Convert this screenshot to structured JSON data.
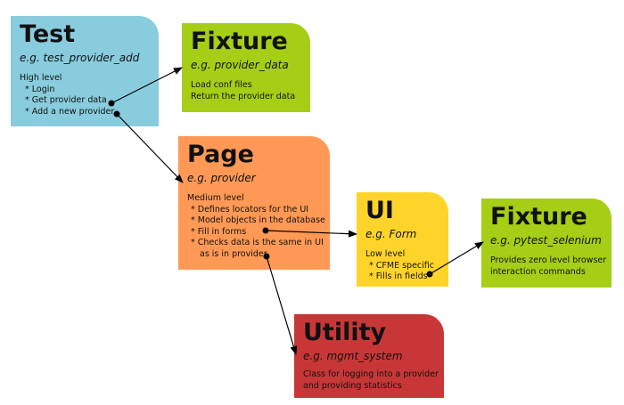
{
  "colors": {
    "test": "#88CCDD",
    "fixture": "#A6CE16",
    "page": "#FF9955",
    "ui": "#FFD42A",
    "utility": "#C83737",
    "arrow": "#000000"
  },
  "boxes": {
    "test": {
      "title": "Test",
      "example": "e.g. test_provider_add",
      "lines": [
        "High level",
        "* Login",
        "* Get provider data",
        "* Add a new provider"
      ]
    },
    "fixture_top": {
      "title": "Fixture",
      "example": "e.g. provider_data",
      "lines": [
        "Load conf files",
        "Return the provider data"
      ]
    },
    "page": {
      "title": "Page",
      "example": "e.g. provider",
      "lines": [
        "Medium level",
        "* Defines locators for the UI",
        "* Model objects in the database",
        "* Fill in forms",
        "* Checks data is the same in UI",
        "as is in provider"
      ]
    },
    "ui": {
      "title": "UI",
      "example": "e.g. Form",
      "lines": [
        "Low level",
        "* CFME specific",
        "* Fills in fields"
      ]
    },
    "fixture_right": {
      "title": "Fixture",
      "example": "e.g. pytest_selenium",
      "lines": [
        "Provides zero level browser",
        "interaction commands"
      ]
    },
    "utility": {
      "title": "Utility",
      "example": "e.g. mgmt_system",
      "lines": [
        "Class for logging into a provider",
        "and providing statistics"
      ]
    }
  }
}
